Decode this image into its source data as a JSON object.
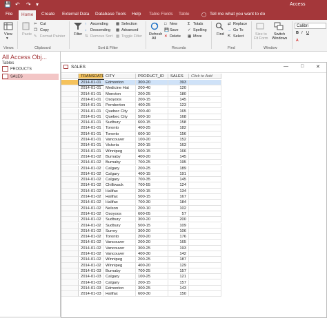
{
  "app": {
    "title": "Access",
    "accent": "#a4373a"
  },
  "menu": {
    "file": "File",
    "home": "Home",
    "create": "Create",
    "external": "External Data",
    "dbtools": "Database Tools",
    "help": "Help",
    "table_fields": "Table Fields",
    "table": "Table",
    "tell_me": "Tell me what you want to do"
  },
  "ribbon": {
    "views": {
      "view": "View",
      "group": "Views"
    },
    "clipboard": {
      "paste": "Paste",
      "cut": "Cut",
      "copy": "Copy",
      "format_painter": "Format Painter",
      "group": "Clipboard"
    },
    "sort": {
      "filter": "Filter",
      "ascending": "Ascending",
      "descending": "Descending",
      "remove_sort": "Remove Sort",
      "selection": "Selection",
      "advanced": "Advanced",
      "toggle_filter": "Toggle Filter",
      "group": "Sort & Filter"
    },
    "records": {
      "refresh": "Refresh",
      "refresh2": "All",
      "new": "New",
      "save": "Save",
      "delete": "Delete",
      "totals": "Totals",
      "spelling": "Spelling",
      "more": "More",
      "group": "Records"
    },
    "find": {
      "find": "Find",
      "replace": "Replace",
      "goto": "Go To",
      "select": "Select",
      "group": "Find"
    },
    "window": {
      "size": "Size to",
      "size2": "Fit Form",
      "switch": "Switch",
      "switch2": "Windows",
      "group": "Window"
    },
    "font": {
      "name": "Calibri"
    }
  },
  "nav": {
    "title": "All Access Obj...",
    "section": "Tables",
    "items": [
      {
        "label": "PRODUCTS"
      },
      {
        "label": "SALES"
      }
    ]
  },
  "table_window": {
    "title": "SALES",
    "columns": [
      "TRANSDATE",
      "CITY",
      "PRODUCT_ID",
      "SALES",
      "Click to Add"
    ],
    "rows": [
      [
        "2014-01-01",
        "Edmonton",
        "300-20",
        "393"
      ],
      [
        "2014-01-01",
        "Medicine Hat",
        "200-40",
        "120"
      ],
      [
        "2014-01-01",
        "Moncton",
        "200-25",
        "180"
      ],
      [
        "2014-01-01",
        "Osoyoos",
        "200-15",
        "145"
      ],
      [
        "2014-01-01",
        "Pemberton",
        "400-25",
        "123"
      ],
      [
        "2014-01-01",
        "Quebec City",
        "200-40",
        "165"
      ],
      [
        "2014-01-01",
        "Quebec City",
        "500-10",
        "168"
      ],
      [
        "2014-01-01",
        "Sudbury",
        "600-15",
        "158"
      ],
      [
        "2014-01-01",
        "Toronto",
        "400-25",
        "182"
      ],
      [
        "2014-01-01",
        "Toronto",
        "600-10",
        "156"
      ],
      [
        "2014-01-01",
        "Vancouver",
        "100-20",
        "152"
      ],
      [
        "2014-01-01",
        "Victoria",
        "200-15",
        "163"
      ],
      [
        "2014-01-01",
        "Winnipeg",
        "500-15",
        "166"
      ],
      [
        "2014-01-02",
        "Burnaby",
        "400-20",
        "145"
      ],
      [
        "2014-01-02",
        "Burnaby",
        "700-25",
        "195"
      ],
      [
        "2014-01-02",
        "Calgary",
        "200-25",
        "189"
      ],
      [
        "2014-01-02",
        "Calgary",
        "400-15",
        "191"
      ],
      [
        "2014-01-02",
        "Calgary",
        "700-35",
        "145"
      ],
      [
        "2014-01-02",
        "Chilliwack",
        "700-55",
        "124"
      ],
      [
        "2014-01-02",
        "Halifax",
        "200-15",
        "134"
      ],
      [
        "2014-01-02",
        "Halifax",
        "500-15",
        "167"
      ],
      [
        "2014-01-02",
        "Halifax",
        "700-30",
        "184"
      ],
      [
        "2014-01-02",
        "Nelson",
        "200-10",
        "102"
      ],
      [
        "2014-01-02",
        "Osoyoos",
        "600-05",
        "57"
      ],
      [
        "2014-01-02",
        "Sudbury",
        "300-20",
        "200"
      ],
      [
        "2014-01-02",
        "Sudbury",
        "500-15",
        "109"
      ],
      [
        "2014-01-02",
        "Surrey",
        "300-20",
        "106"
      ],
      [
        "2014-01-02",
        "Toronto",
        "200-20",
        "176"
      ],
      [
        "2014-01-02",
        "Vancouver",
        "200-20",
        "165"
      ],
      [
        "2014-01-02",
        "Vancouver",
        "300-25",
        "193"
      ],
      [
        "2014-01-02",
        "Vancouver",
        "400-30",
        "142"
      ],
      [
        "2014-01-02",
        "Winnipeg",
        "200-25",
        "187"
      ],
      [
        "2014-01-02",
        "Winnipeg",
        "400-20",
        "129"
      ],
      [
        "2014-01-03",
        "Burnaby",
        "700-25",
        "157"
      ],
      [
        "2014-01-03",
        "Calgary",
        "100-25",
        "121"
      ],
      [
        "2014-01-03",
        "Calgary",
        "200-15",
        "157"
      ],
      [
        "2014-01-03",
        "Edmonton",
        "300-25",
        "143"
      ],
      [
        "2014-01-03",
        "Halifax",
        "600-30",
        "150"
      ]
    ]
  }
}
